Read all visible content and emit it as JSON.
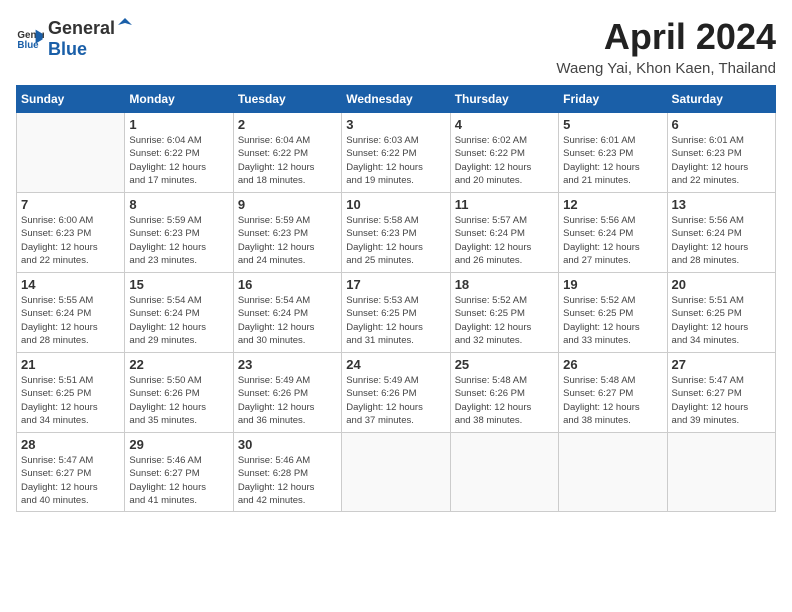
{
  "header": {
    "logo_general": "General",
    "logo_blue": "Blue",
    "month_title": "April 2024",
    "location": "Waeng Yai, Khon Kaen, Thailand"
  },
  "weekdays": [
    "Sunday",
    "Monday",
    "Tuesday",
    "Wednesday",
    "Thursday",
    "Friday",
    "Saturday"
  ],
  "weeks": [
    [
      {
        "day": "",
        "info": ""
      },
      {
        "day": "1",
        "info": "Sunrise: 6:04 AM\nSunset: 6:22 PM\nDaylight: 12 hours\nand 17 minutes."
      },
      {
        "day": "2",
        "info": "Sunrise: 6:04 AM\nSunset: 6:22 PM\nDaylight: 12 hours\nand 18 minutes."
      },
      {
        "day": "3",
        "info": "Sunrise: 6:03 AM\nSunset: 6:22 PM\nDaylight: 12 hours\nand 19 minutes."
      },
      {
        "day": "4",
        "info": "Sunrise: 6:02 AM\nSunset: 6:22 PM\nDaylight: 12 hours\nand 20 minutes."
      },
      {
        "day": "5",
        "info": "Sunrise: 6:01 AM\nSunset: 6:23 PM\nDaylight: 12 hours\nand 21 minutes."
      },
      {
        "day": "6",
        "info": "Sunrise: 6:01 AM\nSunset: 6:23 PM\nDaylight: 12 hours\nand 22 minutes."
      }
    ],
    [
      {
        "day": "7",
        "info": "Sunrise: 6:00 AM\nSunset: 6:23 PM\nDaylight: 12 hours\nand 22 minutes."
      },
      {
        "day": "8",
        "info": "Sunrise: 5:59 AM\nSunset: 6:23 PM\nDaylight: 12 hours\nand 23 minutes."
      },
      {
        "day": "9",
        "info": "Sunrise: 5:59 AM\nSunset: 6:23 PM\nDaylight: 12 hours\nand 24 minutes."
      },
      {
        "day": "10",
        "info": "Sunrise: 5:58 AM\nSunset: 6:23 PM\nDaylight: 12 hours\nand 25 minutes."
      },
      {
        "day": "11",
        "info": "Sunrise: 5:57 AM\nSunset: 6:24 PM\nDaylight: 12 hours\nand 26 minutes."
      },
      {
        "day": "12",
        "info": "Sunrise: 5:56 AM\nSunset: 6:24 PM\nDaylight: 12 hours\nand 27 minutes."
      },
      {
        "day": "13",
        "info": "Sunrise: 5:56 AM\nSunset: 6:24 PM\nDaylight: 12 hours\nand 28 minutes."
      }
    ],
    [
      {
        "day": "14",
        "info": "Sunrise: 5:55 AM\nSunset: 6:24 PM\nDaylight: 12 hours\nand 28 minutes."
      },
      {
        "day": "15",
        "info": "Sunrise: 5:54 AM\nSunset: 6:24 PM\nDaylight: 12 hours\nand 29 minutes."
      },
      {
        "day": "16",
        "info": "Sunrise: 5:54 AM\nSunset: 6:24 PM\nDaylight: 12 hours\nand 30 minutes."
      },
      {
        "day": "17",
        "info": "Sunrise: 5:53 AM\nSunset: 6:25 PM\nDaylight: 12 hours\nand 31 minutes."
      },
      {
        "day": "18",
        "info": "Sunrise: 5:52 AM\nSunset: 6:25 PM\nDaylight: 12 hours\nand 32 minutes."
      },
      {
        "day": "19",
        "info": "Sunrise: 5:52 AM\nSunset: 6:25 PM\nDaylight: 12 hours\nand 33 minutes."
      },
      {
        "day": "20",
        "info": "Sunrise: 5:51 AM\nSunset: 6:25 PM\nDaylight: 12 hours\nand 34 minutes."
      }
    ],
    [
      {
        "day": "21",
        "info": "Sunrise: 5:51 AM\nSunset: 6:25 PM\nDaylight: 12 hours\nand 34 minutes."
      },
      {
        "day": "22",
        "info": "Sunrise: 5:50 AM\nSunset: 6:26 PM\nDaylight: 12 hours\nand 35 minutes."
      },
      {
        "day": "23",
        "info": "Sunrise: 5:49 AM\nSunset: 6:26 PM\nDaylight: 12 hours\nand 36 minutes."
      },
      {
        "day": "24",
        "info": "Sunrise: 5:49 AM\nSunset: 6:26 PM\nDaylight: 12 hours\nand 37 minutes."
      },
      {
        "day": "25",
        "info": "Sunrise: 5:48 AM\nSunset: 6:26 PM\nDaylight: 12 hours\nand 38 minutes."
      },
      {
        "day": "26",
        "info": "Sunrise: 5:48 AM\nSunset: 6:27 PM\nDaylight: 12 hours\nand 38 minutes."
      },
      {
        "day": "27",
        "info": "Sunrise: 5:47 AM\nSunset: 6:27 PM\nDaylight: 12 hours\nand 39 minutes."
      }
    ],
    [
      {
        "day": "28",
        "info": "Sunrise: 5:47 AM\nSunset: 6:27 PM\nDaylight: 12 hours\nand 40 minutes."
      },
      {
        "day": "29",
        "info": "Sunrise: 5:46 AM\nSunset: 6:27 PM\nDaylight: 12 hours\nand 41 minutes."
      },
      {
        "day": "30",
        "info": "Sunrise: 5:46 AM\nSunset: 6:28 PM\nDaylight: 12 hours\nand 42 minutes."
      },
      {
        "day": "",
        "info": ""
      },
      {
        "day": "",
        "info": ""
      },
      {
        "day": "",
        "info": ""
      },
      {
        "day": "",
        "info": ""
      }
    ]
  ]
}
